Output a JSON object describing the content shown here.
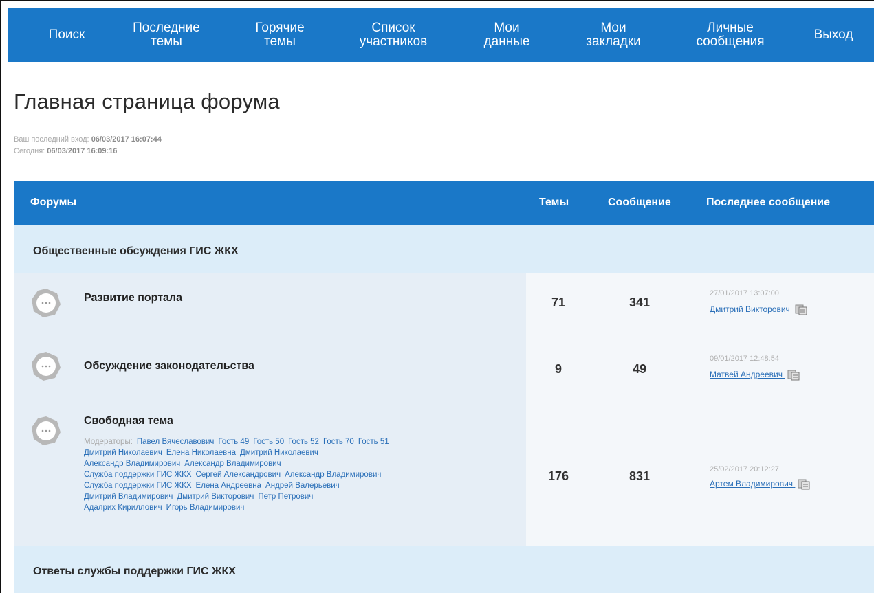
{
  "nav": {
    "items": [
      {
        "label": "Поиск"
      },
      {
        "label": "Последние\nтемы"
      },
      {
        "label": "Горячие\nтемы"
      },
      {
        "label": "Список\nучастников"
      },
      {
        "label": "Мои\nданные"
      },
      {
        "label": "Мои\nзакладки"
      },
      {
        "label": "Личные\nсообщения"
      },
      {
        "label": "Выход"
      }
    ]
  },
  "page": {
    "title": "Главная страница форума",
    "last_visit_label": "Ваш последний вход:",
    "last_visit_value": "06/03/2017 16:07:44",
    "today_label": "Сегодня:",
    "today_value": "06/03/2017 16:09:16"
  },
  "table": {
    "col_forums": "Форумы",
    "col_topics": "Темы",
    "col_posts": "Сообщение",
    "col_last": "Последнее сообщение"
  },
  "categories": [
    {
      "title": "Общественные обсуждения ГИС ЖКХ"
    },
    {
      "title": "Ответы службы поддержки ГИС ЖКХ"
    }
  ],
  "forums": [
    {
      "name": "Развитие портала",
      "topics": "71",
      "posts": "341",
      "last_date": "27/01/2017 13:07:00",
      "last_user": "Дмитрий Викторович"
    },
    {
      "name": "Обсуждение законодательства",
      "topics": "9",
      "posts": "49",
      "last_date": "09/01/2017 12:48:54",
      "last_user": "Матвей Андреевич"
    },
    {
      "name": "Свободная тема",
      "topics": "176",
      "posts": "831",
      "last_date": "25/02/2017 20:12:27",
      "last_user": "Артем Владимирович",
      "moderators_label": "Модераторы:",
      "moderators": [
        "Павел Вячеславович",
        "Гость 49",
        "Гость 50",
        "Гость 52",
        "Гость 70",
        "Гость 51",
        "Дмитрий Николаевич",
        "Елена Николаевна",
        "Дмитрий Николаевич",
        "Александр Владимирович",
        "Александр Владимирович",
        "Служба поддержки ГИС ЖКХ",
        "Сергей Александрович",
        "Александр Владимирович",
        "Служба поддержки ГИС ЖКХ",
        "Елена Андреевна",
        "Андрей Валерьевич",
        "Дмитрий Владимирович",
        "Дмитрий Викторович",
        "Петр Петрович",
        "Адалрих Кириллович",
        "Игорь Владимирович"
      ]
    }
  ],
  "colors": {
    "nav_bg": "#1a78c8",
    "category_bg": "#dcedf9",
    "link": "#2a6fb8"
  }
}
